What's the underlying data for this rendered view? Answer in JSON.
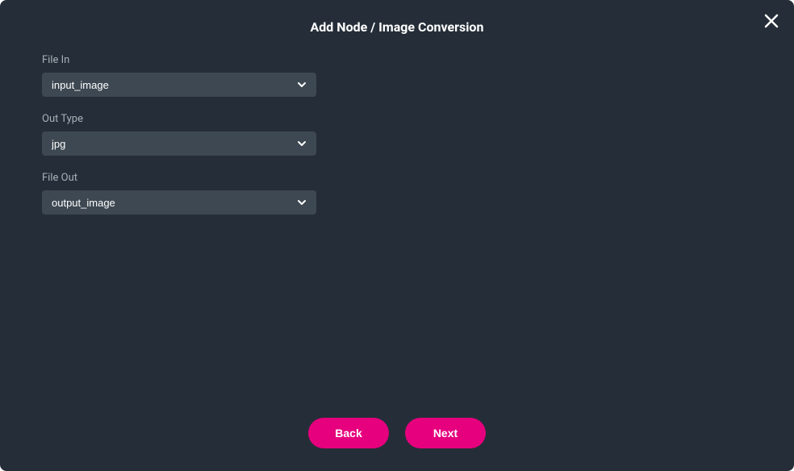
{
  "dialog": {
    "title": "Add Node / Image Conversion"
  },
  "fields": {
    "fileIn": {
      "label": "File In",
      "value": "input_image"
    },
    "outType": {
      "label": "Out Type",
      "value": "jpg"
    },
    "fileOut": {
      "label": "File Out",
      "value": "output_image"
    }
  },
  "buttons": {
    "back": "Back",
    "next": "Next"
  }
}
